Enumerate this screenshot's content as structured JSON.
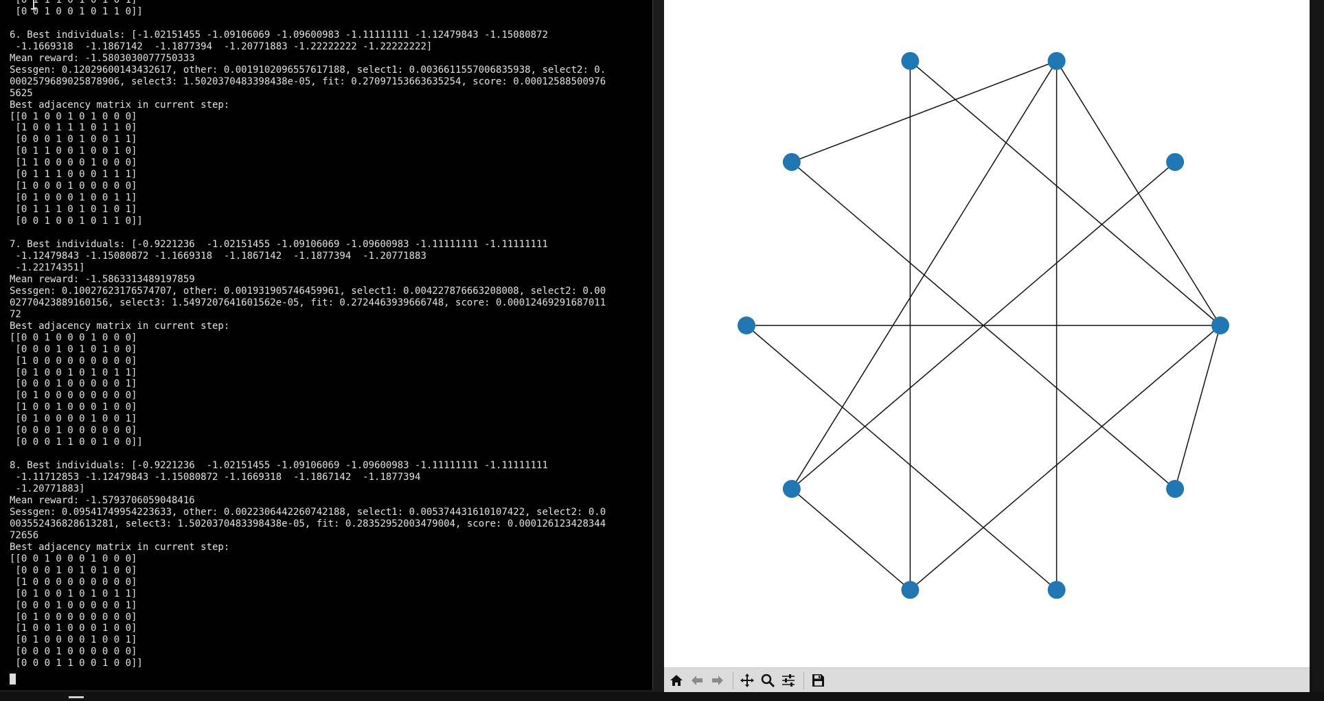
{
  "terminal": {
    "text": " [0 1 1 1 0 1 0 1 0 1]\n [0 0 1 0 0 1 0 1 1 0]]\n\n6. Best individuals: [-1.02151455 -1.09106069 -1.09600983 -1.11111111 -1.12479843 -1.15080872\n -1.1669318  -1.1867142  -1.1877394  -1.20771883 -1.22222222 -1.22222222]\nMean reward: -1.5803030077750333\nSessgen: 0.12029600143432617, other: 0.0019102096557617188, select1: 0.0036611557006835938, select2: 0.\n0002579689025878906, select3: 1.5020370483398438e-05, fit: 0.27097153663635254, score: 0.00012588500976\n5625\nBest adjacency matrix in current step:\n[[0 1 0 0 1 0 1 0 0 0]\n [1 0 0 1 1 1 0 1 1 0]\n [0 0 0 1 0 1 0 0 1 1]\n [0 1 1 0 0 1 0 0 1 0]\n [1 1 0 0 0 0 1 0 0 0]\n [0 1 1 1 0 0 0 1 1 1]\n [1 0 0 0 1 0 0 0 0 0]\n [0 1 0 0 0 1 0 0 1 1]\n [0 1 1 1 0 1 0 1 0 1]\n [0 0 1 0 0 1 0 1 1 0]]\n\n7. Best individuals: [-0.9221236  -1.02151455 -1.09106069 -1.09600983 -1.11111111 -1.11111111\n -1.12479843 -1.15080872 -1.1669318  -1.1867142  -1.1877394  -1.20771883\n -1.22174351]\nMean reward: -1.5863313489197859\nSessgen: 0.10027623176574707, other: 0.001931905746459961, select1: 0.004227876663208008, select2: 0.00\n02770423889160156, select3: 1.5497207641601562e-05, fit: 0.2724463939666748, score: 0.00012469291687011\n72\nBest adjacency matrix in current step:\n[[0 0 1 0 0 0 1 0 0 0]\n [0 0 0 1 0 1 0 1 0 0]\n [1 0 0 0 0 0 0 0 0 0]\n [0 1 0 0 1 0 1 0 1 1]\n [0 0 0 1 0 0 0 0 0 1]\n [0 1 0 0 0 0 0 0 0 0]\n [1 0 0 1 0 0 0 1 0 0]\n [0 1 0 0 0 0 1 0 0 1]\n [0 0 0 1 0 0 0 0 0 0]\n [0 0 0 1 1 0 0 1 0 0]]\n\n8. Best individuals: [-0.9221236  -1.02151455 -1.09106069 -1.09600983 -1.11111111 -1.11111111\n -1.11712853 -1.12479843 -1.15080872 -1.1669318  -1.1867142  -1.1877394\n -1.20771883]\nMean reward: -1.5793706059048416\nSessgen: 0.09541749954223633, other: 0.0022306442260742188, select1: 0.005374431610107422, select2: 0.0\n003552436828613281, select3: 1.5020370483398438e-05, fit: 0.28352952003479004, score: 0.000126123428344\n72656\nBest adjacency matrix in current step:\n[[0 0 1 0 0 0 1 0 0 0]\n [0 0 0 1 0 1 0 1 0 0]\n [1 0 0 0 0 0 0 0 0 0]\n [0 1 0 0 1 0 1 0 1 1]\n [0 0 0 1 0 0 0 0 0 1]\n [0 1 0 0 0 0 0 0 0 0]\n [1 0 0 1 0 0 0 1 0 0]\n [0 1 0 0 0 0 1 0 0 1]\n [0 0 0 1 0 0 0 0 0 0]\n [0 0 0 1 1 0 0 1 0 0]]"
  },
  "graph": {
    "node_color": "#1f77b4",
    "edge_color": "#111111",
    "edges": [
      [
        0,
        3
      ],
      [
        0,
        6
      ],
      [
        1,
        3
      ],
      [
        1,
        5
      ],
      [
        1,
        7
      ],
      [
        1,
        9
      ],
      [
        2,
        7
      ],
      [
        3,
        4
      ],
      [
        3,
        6
      ],
      [
        3,
        8
      ],
      [
        4,
        9
      ],
      [
        5,
        8
      ],
      [
        6,
        7
      ]
    ]
  },
  "toolbar": {
    "buttons": [
      {
        "name": "home-button",
        "icon": "home-icon"
      },
      {
        "name": "back-button",
        "icon": "arrow-left-icon"
      },
      {
        "name": "forward-button",
        "icon": "arrow-right-icon"
      },
      {
        "name": "pan-button",
        "icon": "move-icon"
      },
      {
        "name": "zoom-button",
        "icon": "magnifier-icon"
      },
      {
        "name": "configure-subplots-button",
        "icon": "sliders-icon"
      },
      {
        "name": "save-button",
        "icon": "floppy-disk-icon"
      }
    ]
  }
}
